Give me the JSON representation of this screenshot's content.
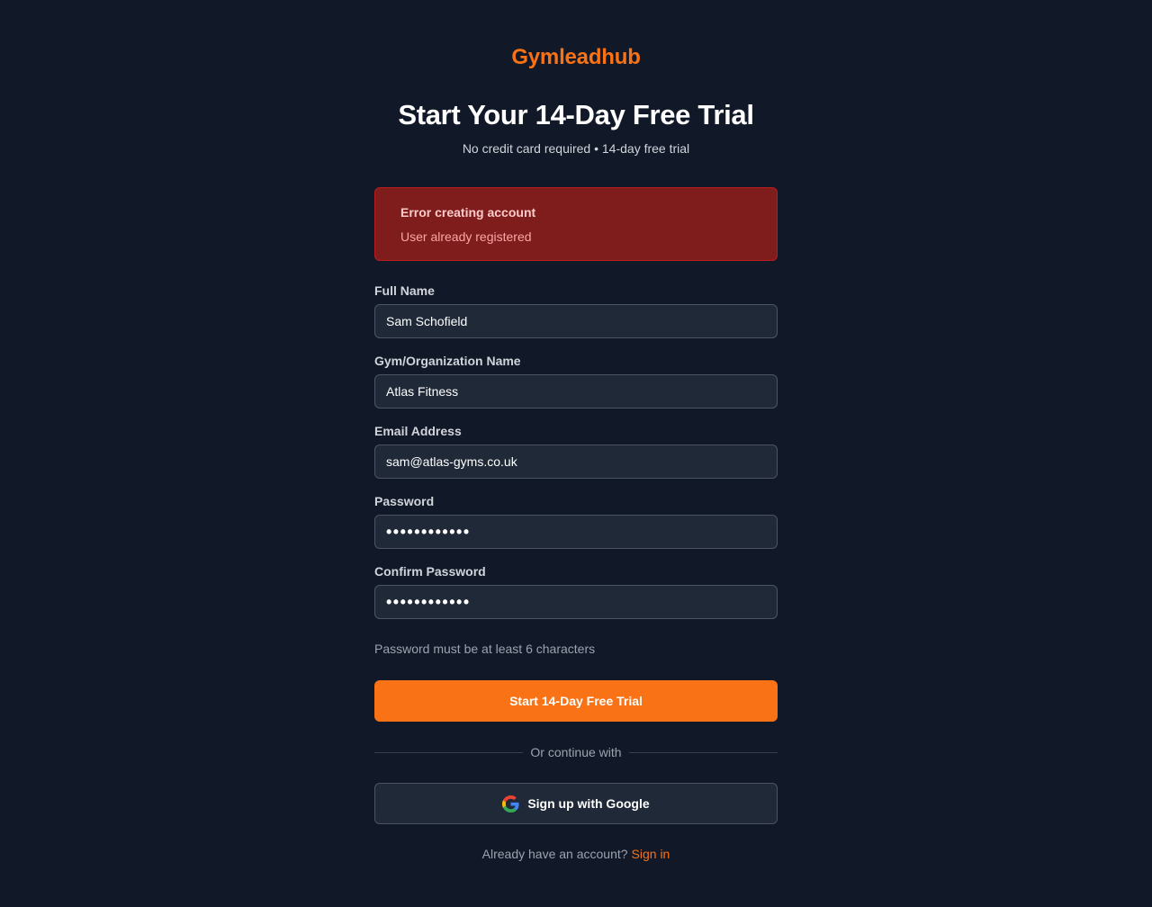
{
  "brand": {
    "name": "Gymleadhub",
    "accent_color": "#f97316"
  },
  "header": {
    "title": "Start Your 14-Day Free Trial",
    "subtitle": "No credit card required • 14-day free trial"
  },
  "error": {
    "title": "Error creating account",
    "message": "User already registered",
    "background_color": "#7f1d1d"
  },
  "form": {
    "full_name": {
      "label": "Full Name",
      "value": "Sam Schofield"
    },
    "organization": {
      "label": "Gym/Organization Name",
      "value": "Atlas Fitness"
    },
    "email": {
      "label": "Email Address",
      "value": "sam@atlas-gyms.co.uk"
    },
    "password": {
      "label": "Password",
      "value": "••••••••••••"
    },
    "confirm_password": {
      "label": "Confirm Password",
      "value": "••••••••••••"
    },
    "hint": "Password must be at least 6 characters",
    "submit_label": "Start 14-Day Free Trial"
  },
  "divider": {
    "text": "Or continue with"
  },
  "google": {
    "label": "Sign up with Google",
    "icon": "google-icon"
  },
  "footer": {
    "prompt": "Already have an account?",
    "link_label": "Sign in"
  }
}
